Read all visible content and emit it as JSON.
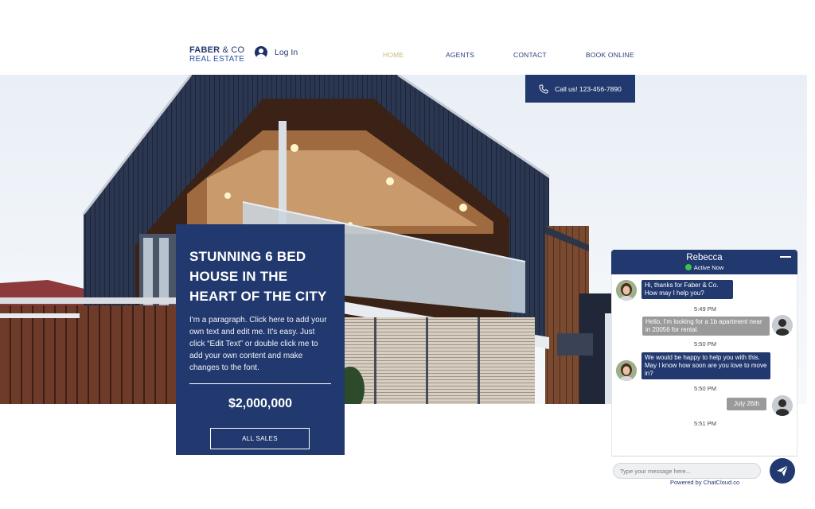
{
  "header": {
    "logo_line1": "FABER",
    "logo_amp": "& CO",
    "logo_line2": "REAL ESTATE",
    "login_label": "Log In",
    "nav": [
      "HOME",
      "AGENTS",
      "CONTACT",
      "BOOK ONLINE"
    ],
    "active_nav": "HOME",
    "accent_color": "#22396f",
    "active_nav_color": "#c9b77a"
  },
  "call_button": {
    "label": "Call us! 123-456-7890",
    "icon": "phone-icon"
  },
  "listing": {
    "title": "STUNNING 6 BED HOUSE IN THE HEART OF THE CITY",
    "description": "I'm a paragraph. Click here to add your own text and edit me. It's easy. Just click “Edit Text” or double click me to add your own content and make changes to the font.",
    "price": "$2,000,000",
    "button_label": "ALL SALES"
  },
  "chat": {
    "agent_name": "Rebecca",
    "status": "Active Now",
    "status_color": "#39c44a",
    "messages": [
      {
        "from": "agent",
        "text": "Hi, thanks for Faber & Co. How may I help you?"
      },
      {
        "from": "stamp",
        "text": "5:49 PM"
      },
      {
        "from": "user",
        "text": "Hello, I'm looking for a 1b apartment near in 20056 for rental."
      },
      {
        "from": "stamp",
        "text": "5:50 PM"
      },
      {
        "from": "agent",
        "text": "We would be happy to help you with this. May I know how soon are you love to move in?"
      },
      {
        "from": "stamp",
        "text": "5:50 PM"
      },
      {
        "from": "user",
        "text": "July 26th"
      },
      {
        "from": "stamp",
        "text": "5:51 PM"
      }
    ],
    "input_placeholder": "Type your message here...",
    "powered_by": "Powered by ChatCloud.co"
  }
}
